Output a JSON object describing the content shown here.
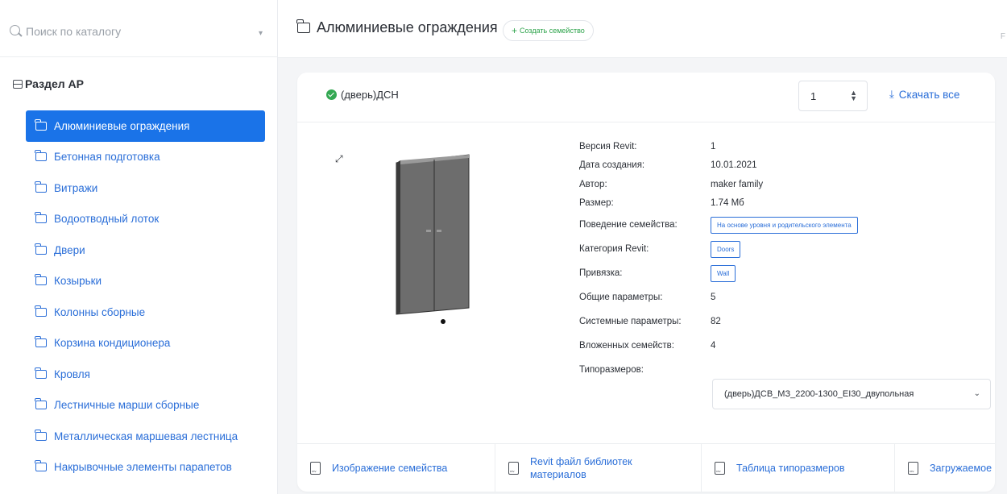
{
  "search": {
    "placeholder": "Поиск по каталогу"
  },
  "sidebar": {
    "section_title": "Раздел АР",
    "items": [
      {
        "label": "Алюминиевые ограждения",
        "active": true
      },
      {
        "label": "Бетонная подготовка"
      },
      {
        "label": "Витражи"
      },
      {
        "label": "Водоотводный лоток"
      },
      {
        "label": "Двери"
      },
      {
        "label": "Козырьки"
      },
      {
        "label": "Колонны сборные"
      },
      {
        "label": "Корзина кондиционера"
      },
      {
        "label": "Кровля"
      },
      {
        "label": "Лестничные марши сборные"
      },
      {
        "label": "Металлическая маршевая лестница"
      },
      {
        "label": "Накрывочные элементы парапетов"
      }
    ]
  },
  "header": {
    "title": "Алюминиевые ограждения",
    "create_label": "Создать семейство",
    "create_plus": "+",
    "right_cut": "F"
  },
  "card": {
    "family_name": "(дверь)ДСН",
    "quantity": "1",
    "download_all": "Скачать все",
    "props": [
      {
        "key": "Версия Revit:",
        "value": "1"
      },
      {
        "key": "Дата создания:",
        "value": "10.01.2021"
      },
      {
        "key": "Автор:",
        "value": "maker family"
      },
      {
        "key": "Размер:",
        "value": "1.74 Мб"
      },
      {
        "key": "Поведение семейства:",
        "chip": "На основе уровня и родительского элемента"
      },
      {
        "key": "Категория Revit:",
        "chip": "Doors"
      },
      {
        "key": "Привязка:",
        "chip": "Wall"
      },
      {
        "key": "Общие параметры:",
        "value": "5"
      },
      {
        "key": "Системные параметры:",
        "value": "82"
      },
      {
        "key": "Вложенных семейств:",
        "value": "4"
      },
      {
        "key": "Типоразмеров:"
      }
    ],
    "type_size_value": "(дверь)ДСВ_МЗ_2200-1300_EI30_двупольная",
    "file_tabs": [
      {
        "label": "Изображение семейства"
      },
      {
        "label": "Revit файл библиотек материалов"
      },
      {
        "label": "Таблица типоразмеров"
      },
      {
        "label": "Загружаемое"
      }
    ]
  },
  "colors": {
    "accent": "#1a73e8",
    "link": "#2a6ed8",
    "success": "#34a853"
  }
}
